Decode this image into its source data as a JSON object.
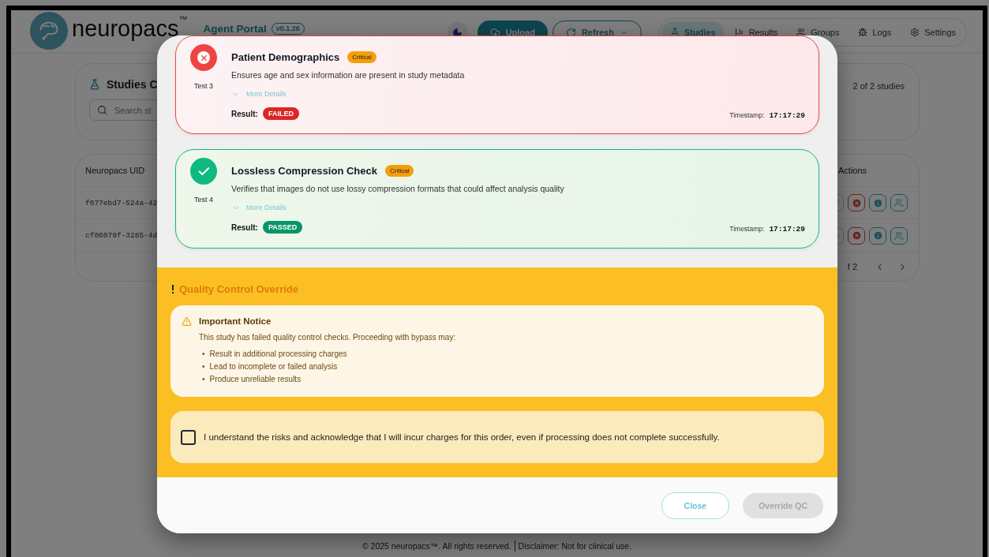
{
  "header": {
    "logo": "neuropacs",
    "trademark": "™",
    "app_title": "Agent Portal",
    "version": "v0.1.26",
    "buttons": [
      {
        "label": "Upload",
        "kind": "primary"
      },
      {
        "label": "Refresh",
        "kind": "outline"
      }
    ],
    "nav": [
      {
        "label": "Studies",
        "selected": true
      },
      {
        "label": "Results",
        "selected": false
      },
      {
        "label": "Groups",
        "selected": false
      },
      {
        "label": "Logs",
        "selected": false
      },
      {
        "label": "Settings",
        "selected": false
      }
    ]
  },
  "studies_panel": {
    "title": "Studies C",
    "search": {
      "placeholder": "Search st"
    },
    "count": "2 of 2 studies"
  },
  "table": {
    "columns": [
      "Neuropacs UID",
      "Actions"
    ],
    "rows": [
      {
        "uid": "f077ebd7-524a-42"
      },
      {
        "uid": "cf06079f-3285-4d"
      }
    ],
    "pagination": "f 2"
  },
  "dialog": {
    "tests": [
      {
        "kind": "failed",
        "test_label": "Test 3",
        "name": "Patient Demographics",
        "severity": "Critical",
        "description": "Ensures age and sex information are present in study metadata",
        "details_link": "More Details",
        "result_label": "Result:",
        "result": "FAILED",
        "timestamp_label": "Timestamp:",
        "timestamp": "17:17:29"
      },
      {
        "kind": "passed",
        "test_label": "Test 4",
        "name": "Lossless Compression Check",
        "severity": "Critical",
        "description": "Verifies that images do not use lossy compression formats that could affect analysis quality",
        "details_link": "More Details",
        "result_label": "Result:",
        "result": "PASSED",
        "timestamp_label": "Timestamp:",
        "timestamp": "17:17:29"
      }
    ],
    "override": {
      "title": "Quality Control Override",
      "notice": {
        "title": "Important Notice",
        "text": "This study has failed quality control checks. Proceeding with bypass may:",
        "marker": "•",
        "items": [
          "Result in additional processing charges",
          "Lead to incomplete or failed analysis",
          "Produce unreliable results"
        ]
      },
      "acknowledgement": {
        "text": "I understand the risks and acknowledge that I will incur charges for this order, even if processing does not complete successfully.",
        "checked": false
      }
    },
    "buttons": [
      {
        "label": "Close",
        "kind": "outline",
        "disabled": false
      },
      {
        "label": "Override QC",
        "kind": "primary",
        "disabled": true
      }
    ]
  },
  "footer": {
    "copyright": "© 2025 neuropacs™. All rights reserved.",
    "disclaimer": "Disclaimer: Not for clinical use."
  }
}
